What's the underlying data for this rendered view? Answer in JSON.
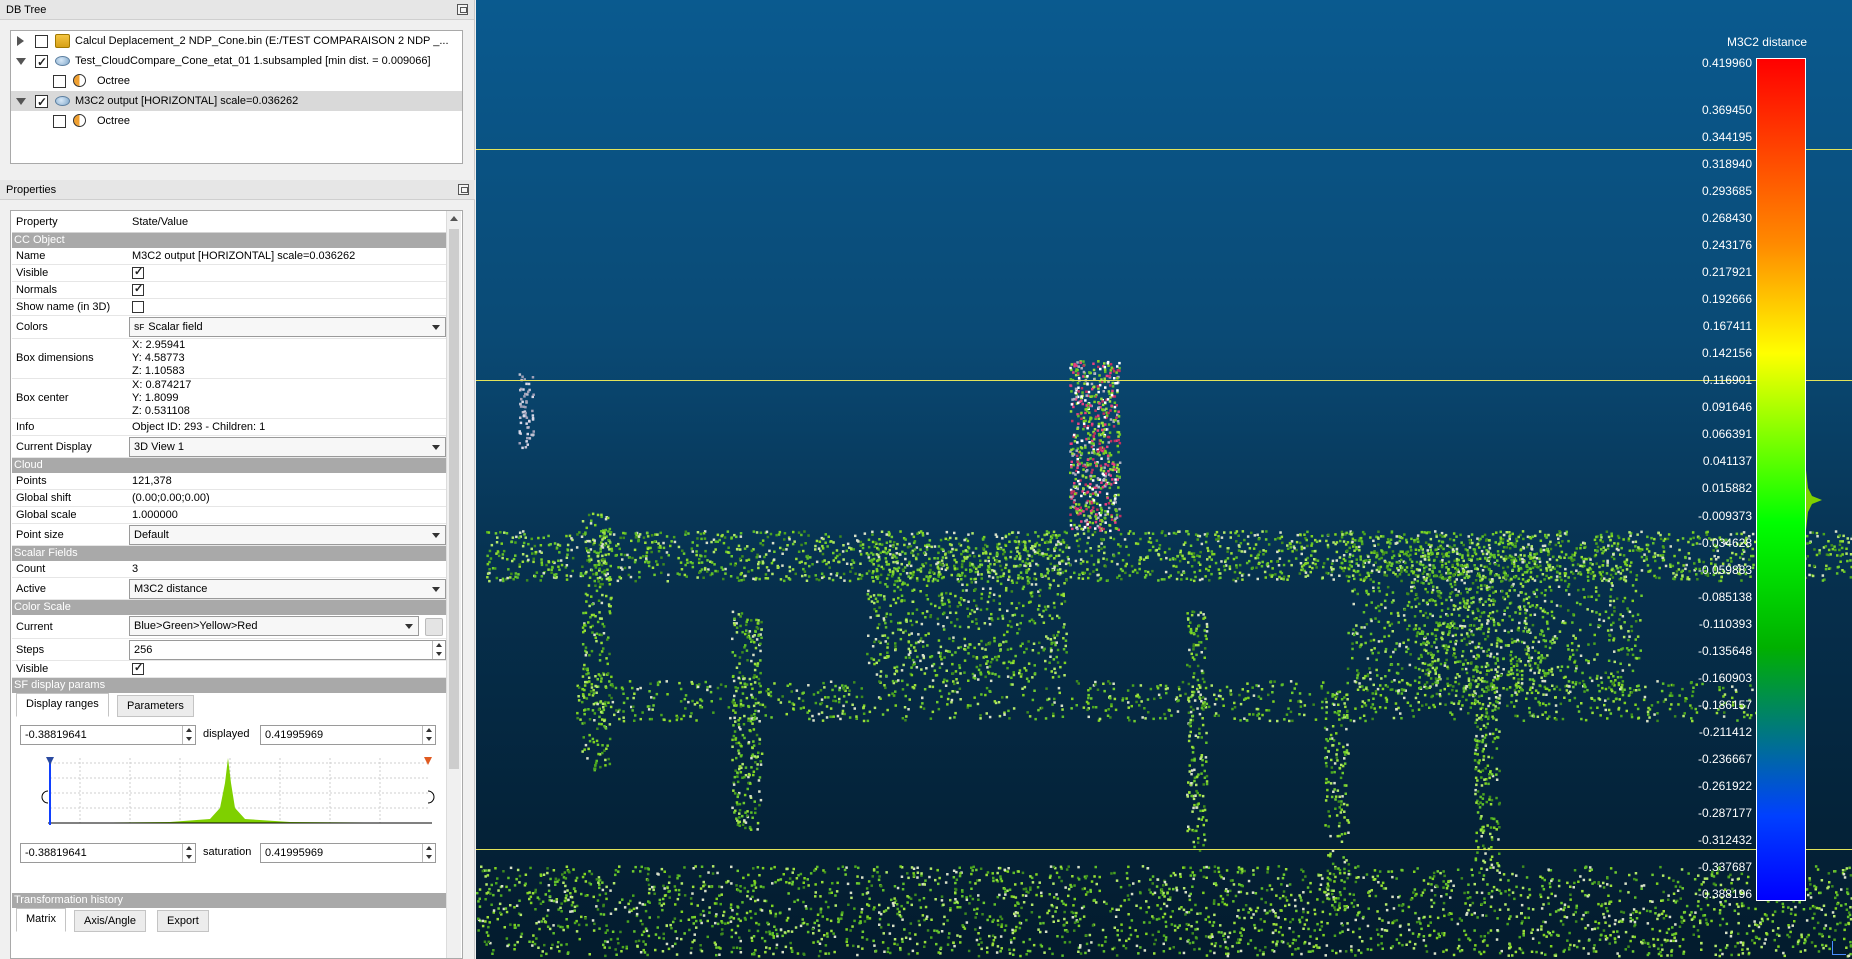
{
  "dbtree": {
    "title": "DB Tree",
    "items": [
      {
        "label": "Calcul Deplacement_2 NDP_Cone.bin (E:/TEST COMPARAISON 2 NDP _...",
        "checked": false
      },
      {
        "label": "Test_CloudCompare_Cone_etat_01 1.subsampled [min dist. = 0.009066]",
        "checked": true
      },
      {
        "label": "Octree",
        "checked": false
      },
      {
        "label": "M3C2 output [HORIZONTAL] scale=0.036262",
        "checked": true
      },
      {
        "label": "Octree",
        "checked": false
      }
    ]
  },
  "properties": {
    "title": "Properties",
    "header": {
      "property": "Property",
      "value": "State/Value"
    },
    "sections": {
      "cc_object": "CC Object",
      "cloud": "Cloud",
      "scalar_fields": "Scalar Fields",
      "color_scale": "Color Scale",
      "sf_display": "SF display params",
      "transform": "Transformation history"
    },
    "rows": {
      "name_k": "Name",
      "name_v": "M3C2 output [HORIZONTAL] scale=0.036262",
      "visible_k": "Visible",
      "normals_k": "Normals",
      "showname_k": "Show name (in 3D)",
      "colors_k": "Colors",
      "colors_v": "Scalar field",
      "sf_badge": "SF",
      "boxdim_k": "Box dimensions",
      "boxdim_x": "X: 2.95941",
      "boxdim_y": "Y: 4.58773",
      "boxdim_z": "Z: 1.10583",
      "boxcenter_k": "Box center",
      "boxcenter_x": "X: 0.874217",
      "boxcenter_y": "Y: 1.8099",
      "boxcenter_z": "Z: 0.531108",
      "info_k": "Info",
      "info_v": "Object ID: 293 - Children: 1",
      "display_k": "Current Display",
      "display_v": "3D View 1",
      "points_k": "Points",
      "points_v": "121,378",
      "gshift_k": "Global shift",
      "gshift_v": "(0.00;0.00;0.00)",
      "gscale_k": "Global scale",
      "gscale_v": "1.000000",
      "psize_k": "Point size",
      "psize_v": "Default",
      "count_k": "Count",
      "count_v": "3",
      "active_k": "Active",
      "active_v": "M3C2 distance",
      "current_k": "Current",
      "current_v": "Blue>Green>Yellow>Red",
      "steps_k": "Steps",
      "steps_v": "256",
      "csvisible_k": "Visible"
    },
    "tabs": {
      "display_ranges": "Display ranges",
      "parameters": "Parameters"
    },
    "ranges": {
      "disp_min": "-0.38819641",
      "displayed_label": "displayed",
      "disp_max": "0.41995969",
      "sat_min": "-0.38819641",
      "saturation_label": "saturation",
      "sat_max": "0.41995969"
    },
    "bottom_tabs": [
      "Matrix",
      "Axis/Angle",
      "Export"
    ]
  },
  "view3d": {
    "scale_title": "M3C2 distance",
    "scale_labels": [
      "0.419960",
      "0.369450",
      "0.344195",
      "0.318940",
      "0.293685",
      "0.268430",
      "0.243176",
      "0.217921",
      "0.192666",
      "0.167411",
      "0.142156",
      "0.116901",
      "0.091646",
      "0.066391",
      "0.041137",
      "0.015882",
      "-0.009373",
      "-0.034628",
      "-0.059883",
      "-0.085138",
      "-0.110393",
      "-0.135648",
      "-0.160903",
      "-0.186157",
      "-0.211412",
      "-0.236667",
      "-0.261922",
      "-0.287177",
      "-0.312432",
      "-0.337687",
      "-0.388196"
    ],
    "colors": {
      "top": "#ff0000",
      "mid": "#00ff00",
      "bottom": "#0000ff",
      "guide_line": "#e3e35a"
    }
  }
}
